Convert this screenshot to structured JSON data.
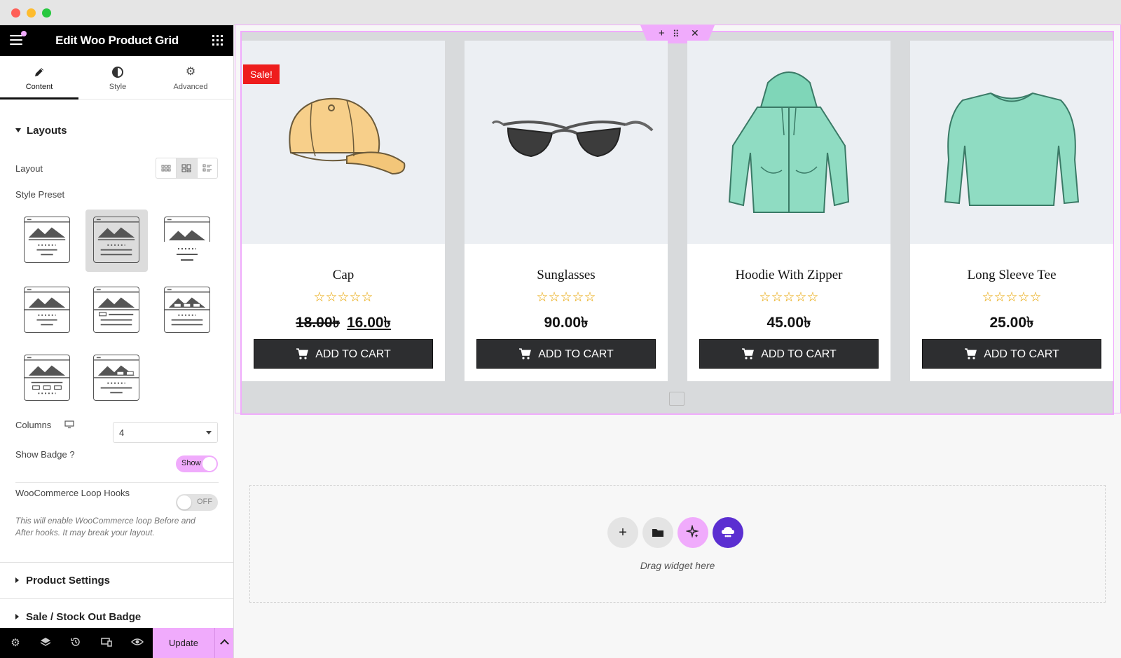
{
  "panel": {
    "title": "Edit Woo Product Grid",
    "tabs": [
      {
        "label": "Content",
        "icon": "pencil-icon"
      },
      {
        "label": "Style",
        "icon": "half-circle-icon"
      },
      {
        "label": "Advanced",
        "icon": "gear-icon"
      }
    ],
    "layouts": {
      "heading": "Layouts",
      "layout_label": "Layout",
      "style_preset_label": "Style Preset",
      "columns_label": "Columns",
      "columns_value": "4",
      "show_badge_label": "Show Badge ?",
      "show_badge_value": "Show",
      "loop_hooks_label": "WooCommerce Loop Hooks",
      "loop_hooks_value": "OFF",
      "loop_hooks_note": "This will enable WooCommerce loop Before and After hooks. It may break your layout."
    },
    "product_settings_heading": "Product Settings",
    "next_section_heading": "Sale / Stock Out Badge",
    "bottombar": {
      "update_label": "Update"
    }
  },
  "products": [
    {
      "name": "Cap",
      "rating": "☆☆☆☆☆",
      "old_price": "18.00৳",
      "price": "16.00৳",
      "badge": "Sale!",
      "button": "ADD TO CART"
    },
    {
      "name": "Sunglasses",
      "rating": "☆☆☆☆☆",
      "price": "90.00৳",
      "button": "ADD TO CART"
    },
    {
      "name": "Hoodie With Zipper",
      "rating": "☆☆☆☆☆",
      "price": "45.00৳",
      "button": "ADD TO CART"
    },
    {
      "name": "Long Sleeve Tee",
      "rating": "☆☆☆☆☆",
      "price": "25.00৳",
      "button": "ADD TO CART"
    }
  ],
  "dropzone": {
    "text": "Drag widget here"
  },
  "colors": {
    "accent": "#f0abfc",
    "sale": "#ee1d1d",
    "button": "#2d2e30",
    "star": "#e8a400",
    "brand_purple": "#5b2fd1"
  }
}
